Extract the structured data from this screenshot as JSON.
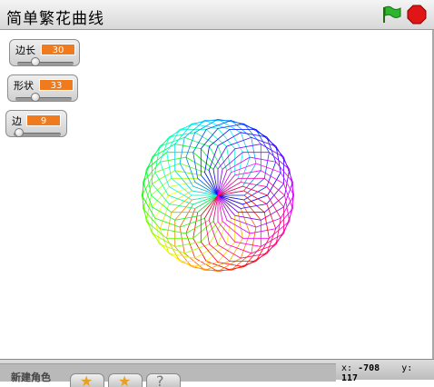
{
  "title": "简单繁花曲线",
  "controls": {
    "green_flag": "green-flag-icon",
    "stop": "stop-sign-icon"
  },
  "monitors": [
    {
      "label": "边长",
      "value": "30",
      "slider_fraction": 0.3
    },
    {
      "label": "形状",
      "value": "33",
      "slider_fraction": 0.33
    },
    {
      "label": "边",
      "value": "9",
      "slider_fraction": 0.09
    }
  ],
  "pattern": {
    "petals": 36,
    "polygon_sides": 9,
    "coloring": "rainbow"
  },
  "bottom": {
    "new_sprite_label": "新建角色",
    "buttons": [
      "paint-new-sprite-icon",
      "choose-sprite-icon",
      "random-sprite-icon"
    ]
  },
  "coords": {
    "x_label": "x:",
    "x": "-708",
    "y_label": "y:",
    "y": "117"
  },
  "colors": {
    "monitor_value_bg": "#f07a1e",
    "green_flag": "#22a822",
    "stop": "#dd1111"
  }
}
